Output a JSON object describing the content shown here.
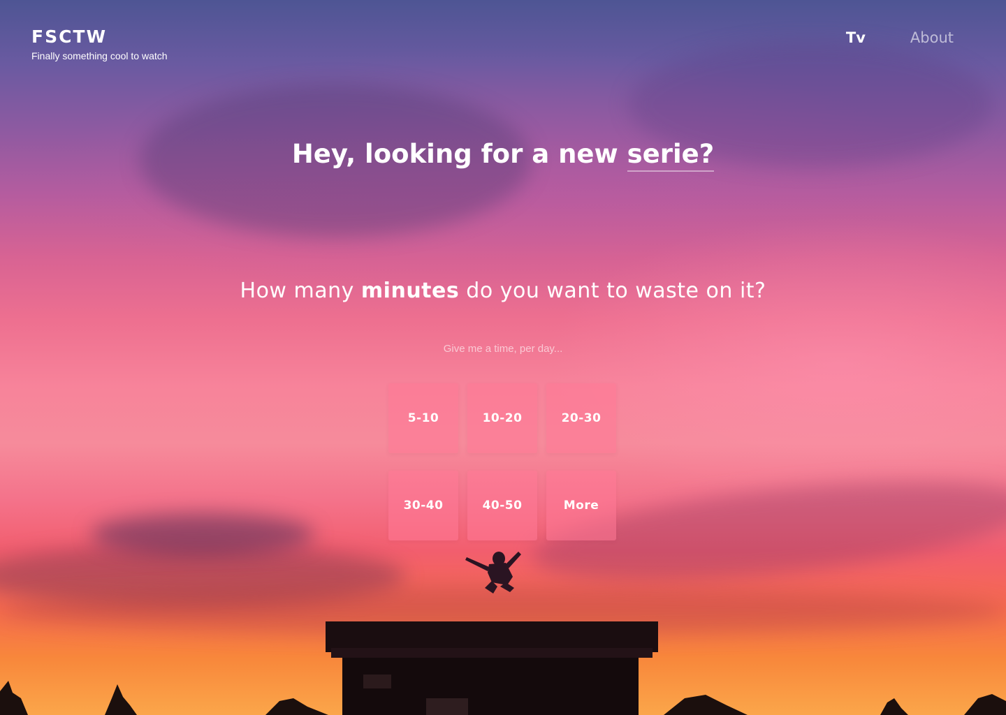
{
  "brand": {
    "title": "FSCTW",
    "tagline": "Finally something cool to watch"
  },
  "nav": {
    "items": [
      {
        "label": "Tv",
        "active": true
      },
      {
        "label": "About",
        "active": false
      }
    ]
  },
  "hero": {
    "headline_prefix": "Hey, looking for a new ",
    "headline_highlight": "serie?",
    "question_prefix": "How many ",
    "question_emphasis": "minutes",
    "question_suffix": " do you want to waste on it?",
    "hint": "Give me a time, per day..."
  },
  "options": [
    "5-10",
    "10-20",
    "20-30",
    "30-40",
    "40-50",
    "More"
  ],
  "colors": {
    "text": "#ffffff",
    "tile": "#ff7896"
  }
}
